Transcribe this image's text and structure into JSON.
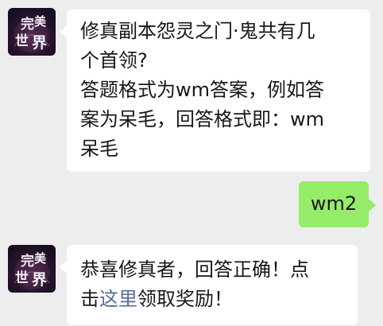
{
  "messages": [
    {
      "sender": "game-account",
      "avatar_text": "完美世界",
      "lines": [
        "修真副本怨灵之门·鬼共有几",
        "个首领?",
        "答题格式为wm答案，例如答",
        "案为呆毛，回答格式即：wm",
        "呆毛"
      ]
    },
    {
      "sender": "user",
      "text": "wm2"
    },
    {
      "sender": "game-account",
      "avatar_text": "完美世界",
      "line1": "恭喜修真者，回答正确！点",
      "line2_prefix": "击",
      "link_text": "这里",
      "line2_suffix": "领取奖励！"
    }
  ],
  "colors": {
    "background": "#ededed",
    "incoming_bubble": "#ffffff",
    "outgoing_bubble": "#95ec69",
    "link": "#576b95"
  }
}
